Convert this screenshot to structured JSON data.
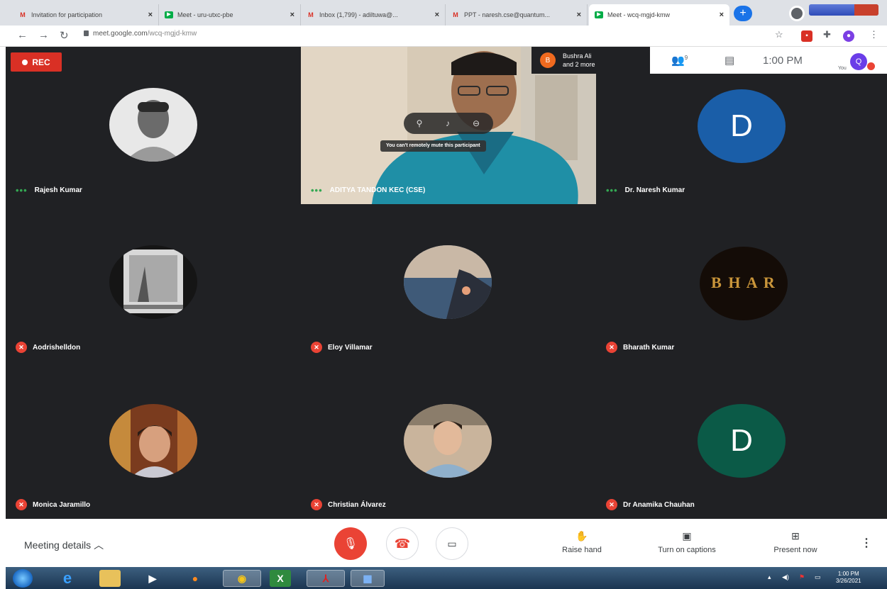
{
  "browser": {
    "tabs": [
      {
        "title": "Invitation for participation",
        "icon": "gmail-icon"
      },
      {
        "title": "Meet - uru-utxc-pbe",
        "icon": "meet-icon"
      },
      {
        "title": "Inbox (1,799) - adiltuwa@...",
        "icon": "gmail-icon"
      },
      {
        "title": "PPT - naresh.cse@quantum...",
        "icon": "gmail-icon"
      },
      {
        "title": "Meet - wcq-mgjd-kmw",
        "icon": "meet-icon"
      }
    ],
    "url_host": "meet.google.com",
    "url_path": "/wcq-mgjd-kmw"
  },
  "meeting": {
    "rec_label": "REC",
    "people_chip": {
      "initial": "B",
      "line1": "Bushra Ali",
      "line2": "and 2 more"
    },
    "clock": "1:00 PM",
    "you_label": "You",
    "me_initial": "Q",
    "participant_count": "9",
    "hover_tooltip": "You can't remotely mute this participant",
    "participants": [
      {
        "name": "Rajesh Kumar",
        "avatar": "photo-bw-man"
      },
      {
        "name": "ADITYA TANDON KEC (CSE)",
        "avatar": "live-video"
      },
      {
        "name": "Dr. Naresh Kumar",
        "avatar": "letter",
        "letter": "D",
        "color": "#1a5ea8"
      },
      {
        "name": "Aodrishelldon",
        "avatar": "photo-car-mirror"
      },
      {
        "name": "Eloy Villamar",
        "avatar": "photo-beach"
      },
      {
        "name": "Bharath Kumar",
        "avatar": "text-logo",
        "logo_text": "B H A R"
      },
      {
        "name": "Monica Jaramillo",
        "avatar": "photo-woman"
      },
      {
        "name": "Christian Álvarez",
        "avatar": "photo-man-car"
      },
      {
        "name": "Dr Anamika Chauhan",
        "avatar": "letter",
        "letter": "D",
        "color": "#0b5a47"
      }
    ]
  },
  "controls": {
    "meeting_details": "Meeting details",
    "raise_hand": "Raise hand",
    "captions": "Turn on captions",
    "present": "Present now"
  },
  "taskbar": {
    "time": "1:00 PM",
    "date": "3/26/2021"
  },
  "colors": {
    "stage_bg": "#202124",
    "rec_red": "#d93025",
    "mute_red": "#ea4335",
    "meet_blue": "#1a73e8"
  }
}
